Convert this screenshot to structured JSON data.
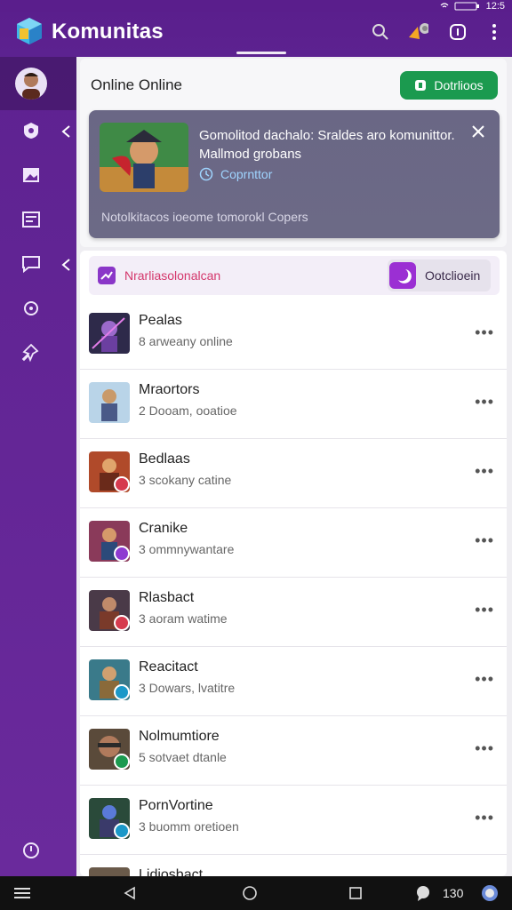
{
  "app": {
    "title": "Komunitas"
  },
  "status": {
    "right_text": "12:5"
  },
  "online": {
    "title": "Online Online",
    "button_label": "Dotrlioos"
  },
  "promo": {
    "message": "Gomolitod dachalo: Sraldes aro komunittor. Mallmod grobans",
    "link_label": "Coprnttor",
    "footer": "Notolkitacos ioeome tomorokl Copers"
  },
  "list": {
    "header_label": "Nrarliasolonalcan",
    "header_button": "Ootclioein",
    "rows": [
      {
        "name": "Pealas",
        "sub": "8 arweany online",
        "badge_color": ""
      },
      {
        "name": "Mraortors",
        "sub": "2 Dooam, ooatioe",
        "badge_color": ""
      },
      {
        "name": "Bedlaas",
        "sub": "3 scokany catine",
        "badge_color": "#d63a4e"
      },
      {
        "name": "Cranike",
        "sub": "3 ommnywantare",
        "badge_color": "#8e3ad1"
      },
      {
        "name": "Rlasbact",
        "sub": "3 aoram watime",
        "badge_color": "#d63a4e"
      },
      {
        "name": "Reacitact",
        "sub": "3 Dowars, lvatitre",
        "badge_color": "#1b98c8"
      },
      {
        "name": "Nolmumtiore",
        "sub": "5 sotvaet dtanle",
        "badge_color": "#1b9a4f"
      },
      {
        "name": "PornVortine",
        "sub": "3 buomm oretioen",
        "badge_color": "#1b98c8"
      },
      {
        "name": "Lidiosbact",
        "sub": "",
        "badge_color": ""
      }
    ]
  },
  "navbar": {
    "time_label": "130"
  }
}
